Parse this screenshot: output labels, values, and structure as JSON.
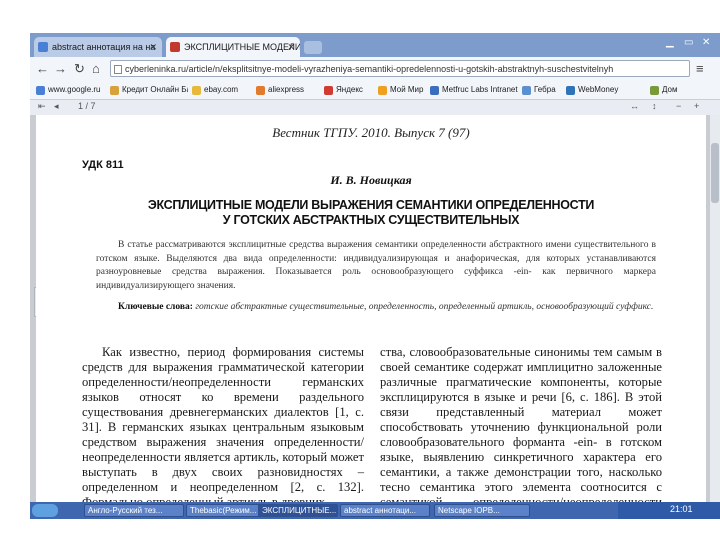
{
  "browser": {
    "tabs": [
      {
        "label": "abstract аннотация на на",
        "active": false
      },
      {
        "label": "ЭКСПЛИЦИТНЫЕ МОДЕЛИ",
        "active": true
      }
    ],
    "url": "cyberleninka.ru/article/n/eksplitsitnye-modeli-vyrazheniya-semantiki-opredelennosti-u-gotskih-abstraktnyh-suschestvitelnyh",
    "bookmarks": [
      "www.google.ru",
      "Кредит Онлайн Банк",
      "ebay.com",
      "aliexpress",
      "Яндекс",
      "Мой Мир",
      "Metfruc Labs Intranet",
      "Гебра",
      "WebMoney",
      "Дом"
    ],
    "pdf_page_indicator": "1 / 7",
    "accent_color": "#7d9ccc"
  },
  "document": {
    "journal": "Вестник ТГПУ. 2010. Выпуск 7 (97)",
    "udk": "УДК 811",
    "author": "И. В. Новицкая",
    "title_line1": "ЭКСПЛИЦИТНЫЕ МОДЕЛИ ВЫРАЖЕНИЯ СЕМАНТИКИ ОПРЕДЕЛЕННОСТИ",
    "title_line2": "У ГОТСКИХ АБСТРАКТНЫХ СУЩЕСТВИТЕЛЬНЫХ",
    "abstract": "В статье рассматриваются эксплицитные средства выражения семантики определенности абстрактного имени существительного в готском языке. Выделяются два вида определенности: индивидуализирующая и анафорическая, для которых устанавливаются разноуровневые средства выражения. Показывается роль основообразующего суффикса -ein- как первичного маркера индивидуализирующего значения.",
    "keywords_label": "Ключевые слова:",
    "keywords": "готские абстрактные существительные, определенность, определенный артикль, основообразующий суффикс.",
    "column_left": "Как известно, период формирования системы средств для выражения грамматической категории определенности/неопределенности германских языков относят ко времени раздельного существования древнегерманских диалектов [1, с. 31]. В германских языках центральным языковым средством выражения значения определенности/неопределенности является артикль, который может выступать в двух своих разновидностях – определенном и неопределенном [2, с. 132]. Формально определенный артикль в древних",
    "column_right": "ства, словообразовательные синонимы тем самым в своей семантике содержат имплицитно заложенные различные прагматические компоненты, которые эксплицируются в языке и речи [6, с. 186]. В этой связи представленный материал может способствовать уточнению функциональной роли словообразовательного форманта -ein- в готском языке, выявлению синкретичного характера его семантики, а также демонстрации того, насколько тесно семантика этого элемента соотносится с семантикой определенности/неопределенности (далее –"
  },
  "taskbar": {
    "items": [
      "Англо-Русский тез...",
      "Thebasic(Режим...",
      "ЭКСПЛИЦИТНЫЕ...",
      "abstract аннотаци...",
      "Netscape IOPB..."
    ],
    "clock": "21:01"
  }
}
